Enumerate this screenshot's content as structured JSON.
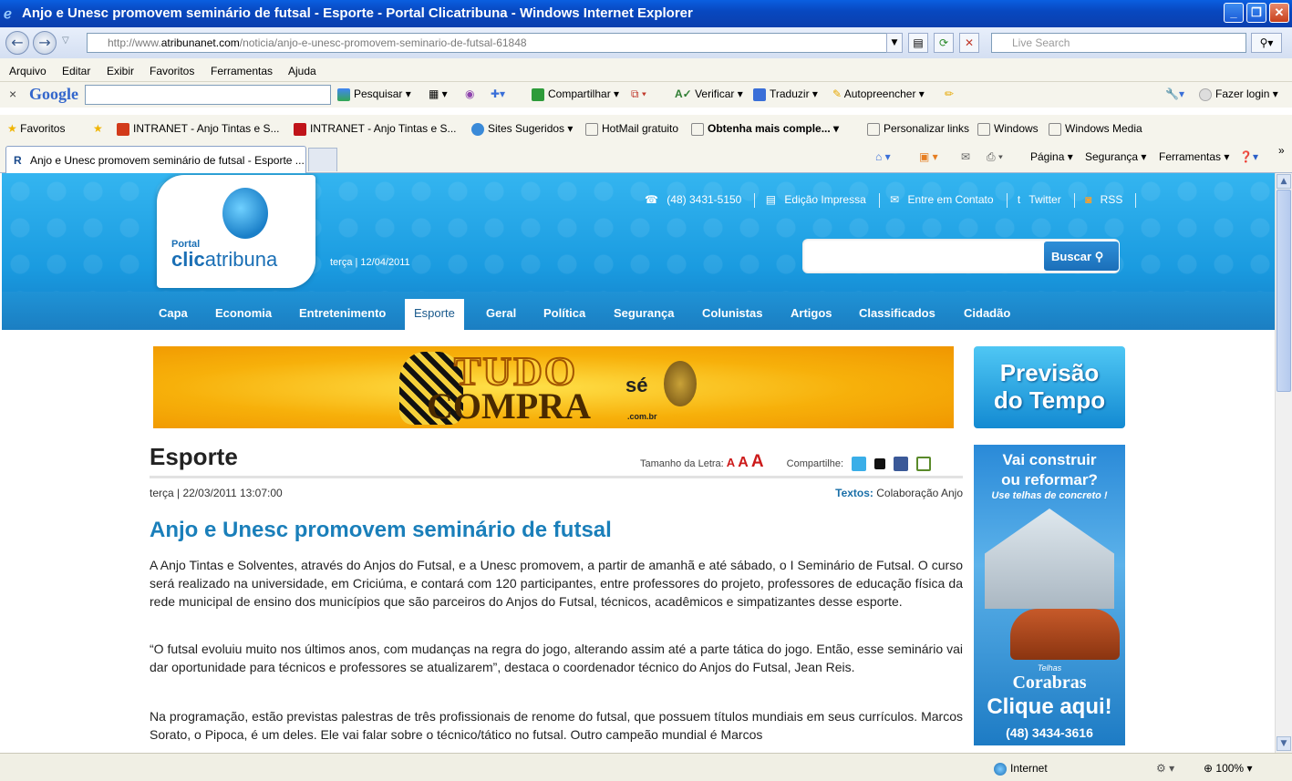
{
  "window": {
    "title": "Anjo e Unesc promovem seminário de futsal - Esporte - Portal Clicatribuna - Windows Internet Explorer"
  },
  "address": {
    "prefix": "http://www.",
    "domain": "atribunanet.com",
    "path": "/noticia/anjo-e-unesc-promovem-seminario-de-futsal-61848",
    "live_search_placeholder": "Live Search"
  },
  "menu": [
    "Arquivo",
    "Editar",
    "Exibir",
    "Favoritos",
    "Ferramentas",
    "Ajuda"
  ],
  "google_toolbar": {
    "brand": "Google",
    "pesquisar": "Pesquisar",
    "compartilhar": "Compartilhar",
    "verificar": "Verificar",
    "traduzir": "Traduzir",
    "preencher": "Autopreencher",
    "login": "Fazer login"
  },
  "favorites": {
    "label": "Favoritos",
    "items": [
      "INTRANET - Anjo Tintas e S...",
      "INTRANET - Anjo Tintas e S...",
      "Sites Sugeridos",
      "HotMail gratuito",
      "Obtenha mais comple...",
      "Personalizar links",
      "Windows",
      "Windows Media"
    ]
  },
  "tab": {
    "title": "Anjo e Unesc promovem seminário de futsal - Esporte ..."
  },
  "commandbar": {
    "pagina": "Página",
    "seguranca": "Segurança",
    "ferramentas": "Ferramentas"
  },
  "site": {
    "logo_portal": "Portal",
    "logo_clic": "clic",
    "logo_atribuna": "atribuna",
    "date": "terça | 12/04/2011",
    "phone": "(48) 3431-5150",
    "edicao": "Edição Impressa",
    "contato": "Entre em Contato",
    "twitter": "Twitter",
    "rss": "RSS",
    "buscar": "Buscar",
    "nav": [
      "Capa",
      "Economia",
      "Entretenimento",
      "Esporte",
      "Geral",
      "Política",
      "Segurança",
      "Colunistas",
      "Artigos",
      "Classificados",
      "Cidadão"
    ],
    "active_nav": "Esporte"
  },
  "banner": {
    "tudo": "TUDO",
    "se": "sé",
    "compra": "COMPRA",
    "com": ".com.br"
  },
  "weather_ad": {
    "line1": "Previsão",
    "line2": "do Tempo"
  },
  "side_ad": {
    "line1": "Vai construir",
    "line2": "ou reformar?",
    "line3": "Use telhas de concreto !",
    "brand_small": "Telhas",
    "brand": "Corabras",
    "cta": "Clique aqui!",
    "phone": "(48) 3434-3616"
  },
  "article": {
    "section": "Esporte",
    "font_size_label": "Tamanho da Letra:",
    "font_a1": "A",
    "font_a2": "A",
    "font_a3": "A",
    "share_label": "Compartilhe:",
    "datetime": "terça | 22/03/2011 13:07:00",
    "credit_label": "Textos:",
    "credit_value": "Colaboração Anjo",
    "headline": "Anjo e Unesc promovem seminário de futsal",
    "p1": "A Anjo Tintas e Solventes, através do Anjos do Futsal, e a Unesc promovem, a partir de amanhã e até sábado, o I Seminário de Futsal. O curso será realizado na universidade, em Criciúma, e contará com 120 participantes, entre professores do projeto, professores de educação física da rede municipal de ensino dos municípios que são parceiros do Anjos do Futsal, técnicos, acadêmicos e simpatizantes desse esporte.",
    "p2": "“O futsal evoluiu muito nos últimos anos, com mudanças na regra do jogo, alterando assim até a parte tática do jogo. Então, esse seminário vai dar oportunidade para técnicos e professores se atualizarem”, destaca o coordenador técnico do Anjos do Futsal, Jean Reis.",
    "p3": "Na programação, estão previstas palestras de três profissionais de renome do futsal, que possuem títulos mundiais em seus currículos. Marcos Sorato, o Pipoca, é um deles. Ele vai falar sobre o técnico/tático no futsal. Outro campeão mundial é Marcos"
  },
  "status": {
    "zone": "Internet",
    "zoom": "100%"
  },
  "colors": {
    "header_blue": "#1a9be0",
    "headline_blue": "#1a7fba",
    "font_red": "#cc1a1a"
  }
}
